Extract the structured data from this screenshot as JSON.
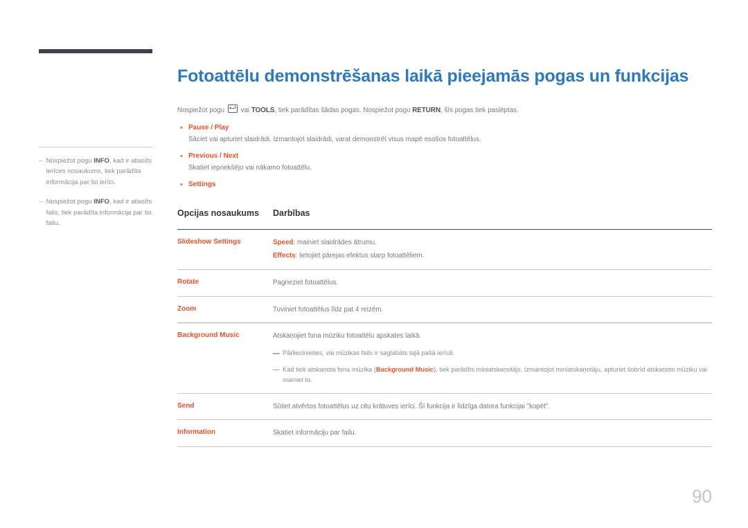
{
  "header": {
    "rule_color": "#453d52"
  },
  "sidebar": {
    "notes": [
      {
        "dash": "–",
        "before": "Nospiežot pogu ",
        "strong": "INFO",
        "after": ", kad ir atlasīts ierīces nosaukums, tiek parādīta informācija par šo ierīci."
      },
      {
        "dash": "–",
        "before": "Nospiežot pogu ",
        "strong": "INFO",
        "after": ", kad ir atlasīts fails, tiek parādīta informācija par šo failu."
      }
    ]
  },
  "main": {
    "title": "Fotoattēlu demonstrēšanas laikā pieejamās pogas un funkcijas",
    "intro": {
      "part1": "Nospiežot pogu",
      "icon": "enter-key-icon",
      "part2": "vai",
      "strong1": "TOOLS",
      "part3": ", tiek parādītas šādas pogas. Nospiežot pogu",
      "strong2": "RETURN",
      "part4": ", šīs pogas tiek paslēptas."
    },
    "bullets": [
      {
        "dot": "•",
        "title": "Pause / Play",
        "desc": "Sāciet vai apturiet slaidrādi. Izmantojot slaidrādi, varat demonstrēt visus mapē esošos fotoattēlus."
      },
      {
        "dot": "•",
        "title": "Previous / Next",
        "desc": "Skatiet iepriekšējo vai nākamo fotoattēlu."
      },
      {
        "dot": "•",
        "title": "Settings",
        "desc": ""
      }
    ],
    "table": {
      "headers": {
        "col1": "Opcijas nosaukums",
        "col2": "Darbības"
      },
      "rows": [
        {
          "name": "Slideshow Settings",
          "lines": [
            {
              "strong": "Speed",
              "text": ": mainiet slaidrādes ātrumu."
            },
            {
              "strong": "Effects",
              "text": ": lietojiet pārejas efektus starp fotoattēliem."
            }
          ]
        },
        {
          "name": "Rotate",
          "lines": [
            {
              "strong": "",
              "text": "Pagrieziet fotoattēlus."
            }
          ]
        },
        {
          "name": "Zoom",
          "lines": [
            {
              "strong": "",
              "text": "Tuviniet fotoattēlus līdz pat 4 reizēm."
            }
          ]
        },
        {
          "name": "Background Music",
          "lines": [
            {
              "strong": "",
              "text": "Atskaņojiet fona mūziku fotoattēlu apskates laikā."
            }
          ],
          "subnotes": [
            {
              "before": "Pārliecinieties, vai mūzikas fails ir saglabāts tajā pašā ierīcē.",
              "strong": "",
              "after": ""
            },
            {
              "before": "Kad tiek atskaņota fona mūzika (",
              "strong": "Background Music",
              "after": "), tiek parādīts miniatskaņotājs. Izmantojot miniatskaņotāju, apturiet šobrīd atskaņoto mūziku vai mainiet to."
            }
          ]
        },
        {
          "name": "Send",
          "lines": [
            {
              "strong": "",
              "text": "Sūtiet atvērtos fotoattēlus uz citu krātuves ierīci. Šī funkcija ir līdzīga datora funkcijai \"kopēt\"."
            }
          ]
        },
        {
          "name": "Information",
          "lines": [
            {
              "strong": "",
              "text": "Skatiet informāciju par failu."
            }
          ]
        }
      ]
    }
  },
  "footer": {
    "page_number": "90"
  },
  "colors": {
    "heading_blue": "#2e78bd",
    "accent_orange": "#e2522a",
    "body_gray": "#77787b",
    "header_bar": "#453d52",
    "page_number": "#c2c4cb",
    "rule_light": "#c9cacc",
    "rule_dark": "#4a4b4e",
    "rule_bgm": "#bfa3a0"
  }
}
